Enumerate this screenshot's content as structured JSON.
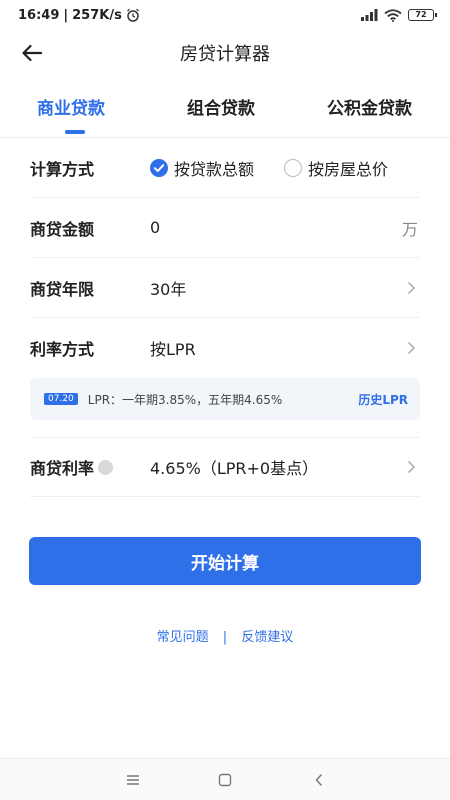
{
  "status_bar": {
    "time": "16:49",
    "speed": "257K/s",
    "battery": "72"
  },
  "header": {
    "title": "房贷计算器"
  },
  "tabs": [
    {
      "label": "商业贷款",
      "active": true
    },
    {
      "label": "组合贷款",
      "active": false
    },
    {
      "label": "公积金贷款",
      "active": false
    }
  ],
  "form": {
    "calc_method": {
      "label": "计算方式",
      "options": [
        {
          "label": "按贷款总额",
          "checked": true
        },
        {
          "label": "按房屋总价",
          "checked": false
        }
      ]
    },
    "amount": {
      "label": "商贷金额",
      "value": "0",
      "unit": "万"
    },
    "term": {
      "label": "商贷年限",
      "value": "30年"
    },
    "rate_method": {
      "label": "利率方式",
      "value": "按LPR"
    },
    "lpr_info": {
      "badge": "07.20",
      "text": "LPR：一年期3.85%，五年期4.65%",
      "link": "历史LPR"
    },
    "rate": {
      "label": "商贷利率",
      "value": "4.65%（LPR+0基点）"
    }
  },
  "actions": {
    "calculate_label": "开始计算"
  },
  "footer_links": {
    "faq": "常见问题",
    "separator": "|",
    "feedback": "反馈建议"
  },
  "colors": {
    "accent": "#2f6fe8",
    "text": "#222222",
    "muted": "#888888"
  }
}
